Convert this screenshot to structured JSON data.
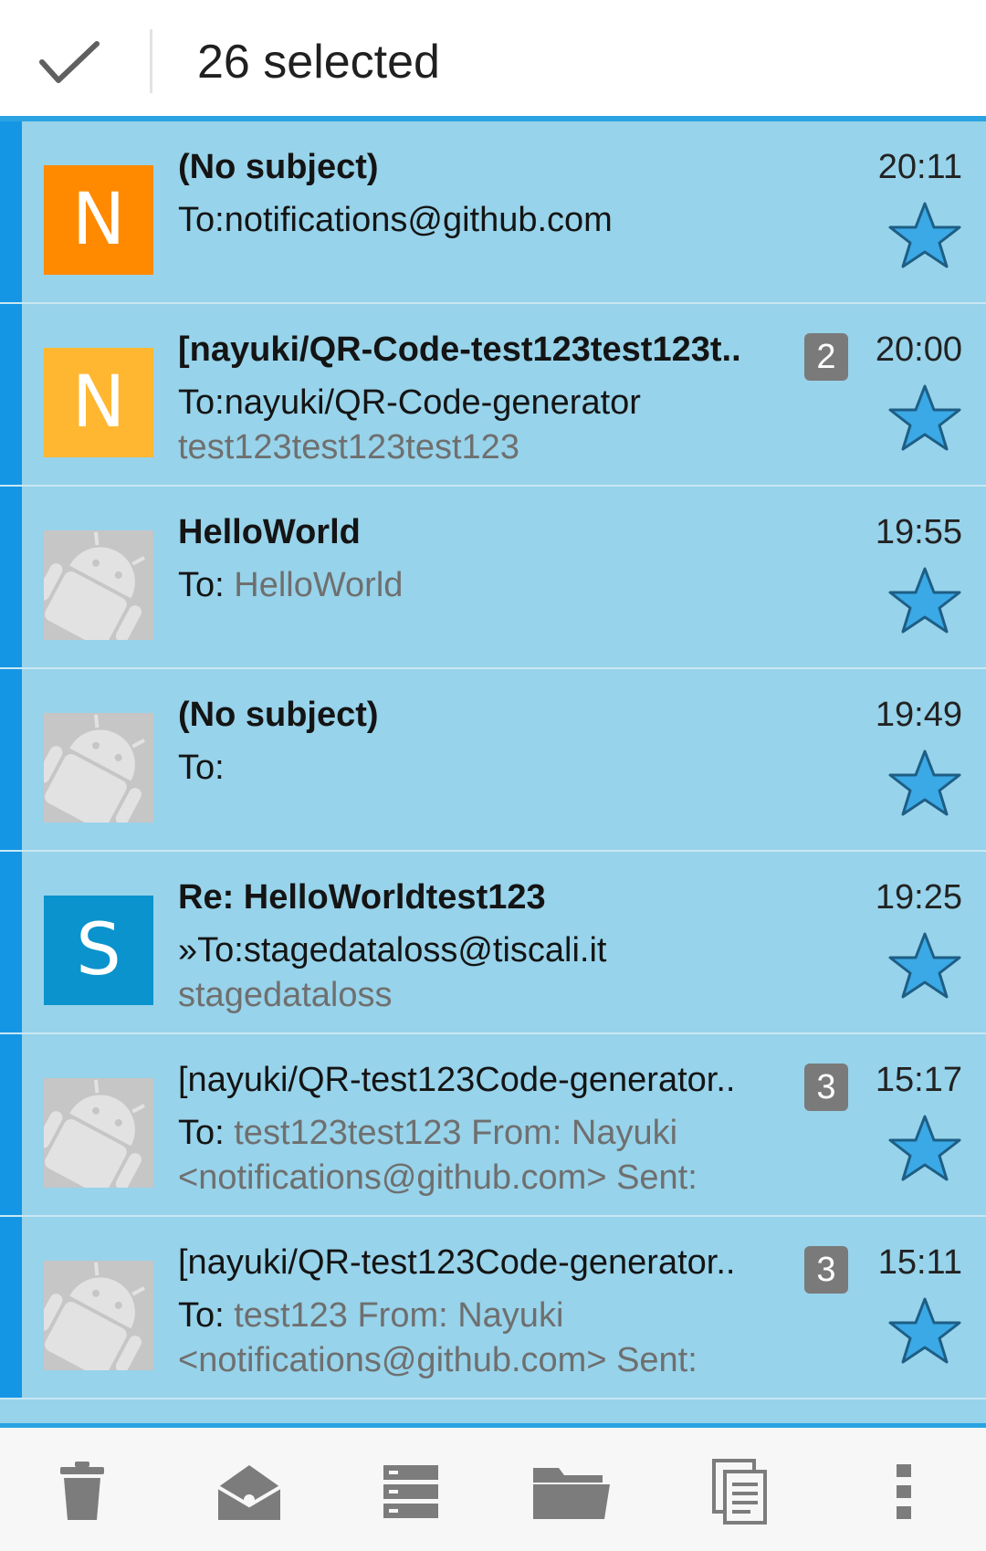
{
  "header": {
    "selected_label": "26 selected",
    "check_icon": "check-icon"
  },
  "colors": {
    "accent": "#29a3e2",
    "selection_bg": "#97d3ea",
    "selection_bar": "#1596e4",
    "star": "#3aa9e6"
  },
  "messages": [
    {
      "avatar": {
        "type": "letter",
        "letter": "N",
        "color": "#ff8a00"
      },
      "subject": "(No subject)",
      "to_prefix": "To:",
      "to_value": "notifications@github.com",
      "snippet": "",
      "time": "20:11",
      "count": "",
      "unread": true
    },
    {
      "avatar": {
        "type": "letter",
        "letter": "N",
        "color": "#ffb732"
      },
      "subject": "[nayuki/QR-Code-test123test123t..",
      "to_prefix": "To:",
      "to_value": "nayuki/QR-Code-generator",
      "snippet": "test123test123test123",
      "time": "20:00",
      "count": "2",
      "unread": true
    },
    {
      "avatar": {
        "type": "android"
      },
      "subject": "HelloWorld",
      "to_prefix": "To: ",
      "to_value": "HelloWorld",
      "snippet": "",
      "time": "19:55",
      "count": "",
      "unread": true
    },
    {
      "avatar": {
        "type": "android"
      },
      "subject": "(No subject)",
      "to_prefix": "To:",
      "to_value": "",
      "snippet": "",
      "time": "19:49",
      "count": "",
      "unread": true
    },
    {
      "avatar": {
        "type": "letter",
        "letter": "S",
        "color": "#0a93cc"
      },
      "subject": "Re: HelloWorldtest123",
      "to_prefix": "»To:",
      "to_value": "stagedataloss@tiscali.it",
      "snippet": "stagedataloss",
      "time": "19:25",
      "count": "",
      "unread": true
    },
    {
      "avatar": {
        "type": "android"
      },
      "subject": "[nayuki/QR-test123Code-generator..",
      "to_prefix": "To: ",
      "to_value": "test123test123 From: Nayuki",
      "snippet": "<notifications@github.com> Sent:",
      "time": "15:17",
      "count": "3",
      "unread": false
    },
    {
      "avatar": {
        "type": "android"
      },
      "subject": "[nayuki/QR-test123Code-generator..",
      "to_prefix": "To: ",
      "to_value": "test123 From: Nayuki",
      "snippet": "<notifications@github.com> Sent:",
      "time": "15:11",
      "count": "3",
      "unread": false
    }
  ],
  "toolbar": {
    "icons": [
      "trash-icon",
      "mark-read-icon",
      "archive-icon",
      "move-folder-icon",
      "copy-icon",
      "overflow-menu-icon"
    ]
  }
}
